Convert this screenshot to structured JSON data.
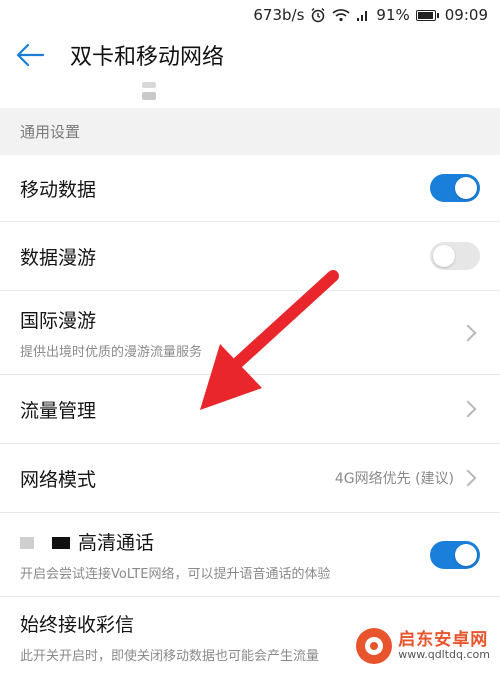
{
  "statusbar": {
    "speed": "673b/s",
    "battery": "91%",
    "time": "09:09"
  },
  "header": {
    "title": "双卡和移动网络"
  },
  "section": {
    "label": "通用设置"
  },
  "rows": {
    "mobile_data": {
      "label": "移动数据",
      "toggle": "on"
    },
    "roaming": {
      "label": "数据漫游",
      "toggle": "off"
    },
    "intl_roaming": {
      "label": "国际漫游",
      "sub": "提供出境时优质的漫游流量服务"
    },
    "traffic": {
      "label": "流量管理"
    },
    "network_mode": {
      "label": "网络模式",
      "value": "4G网络优先 (建议)"
    },
    "hd_call": {
      "label_visible": "高清通话",
      "sub": "开启会尝试连接VoLTE网络，可以提升语音通话的体验",
      "toggle": "on"
    },
    "mms": {
      "label": "始终接收彩信",
      "sub": "此开关开启时，即使关闭移动数据也可能会产生流量"
    }
  },
  "watermark": {
    "name": "启东安卓网",
    "url": "www.qdltdq.com"
  },
  "colors": {
    "accent": "#1a7fdb",
    "arrow": "#e8262b"
  }
}
